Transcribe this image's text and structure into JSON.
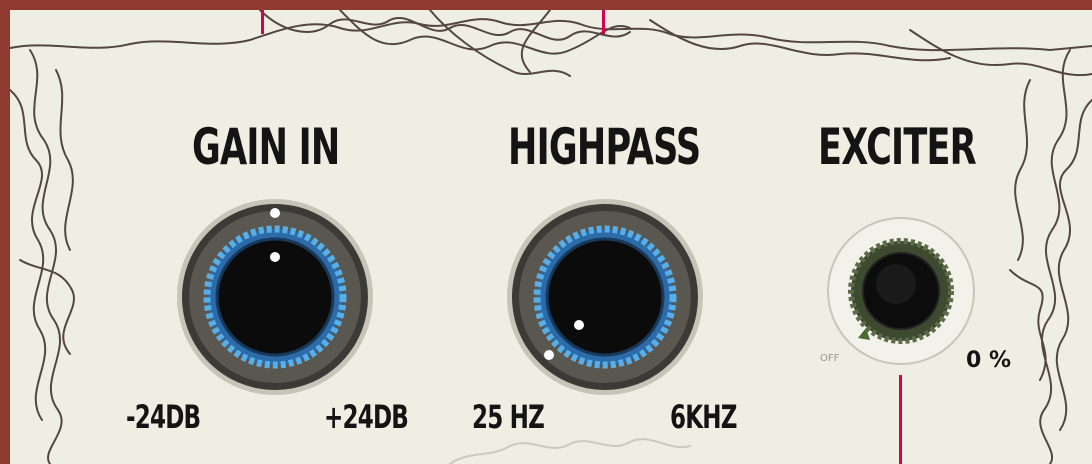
{
  "gain_in": {
    "title": "GAIN IN",
    "min_label": "-24DB",
    "max_label": "+24DB",
    "value_fraction": 0.5
  },
  "highpass": {
    "title": "HIGHPASS",
    "min_label": "25 HZ",
    "max_label": "6KHZ",
    "value_fraction": 0.0
  },
  "exciter": {
    "title": "EXCITER",
    "off_label": "OFF",
    "value_display": "0 %",
    "value_fraction": 0.0
  },
  "colors": {
    "frame": "#8e3a30",
    "paper": "#efeee2",
    "knob_ring_blue": "#3d8fd6",
    "knob_ring_green": "#3d4a30",
    "marker": "#d6004e"
  },
  "icons": {
    "knob": "rotary-knob-icon",
    "sketch": "ink-sketch-border"
  }
}
